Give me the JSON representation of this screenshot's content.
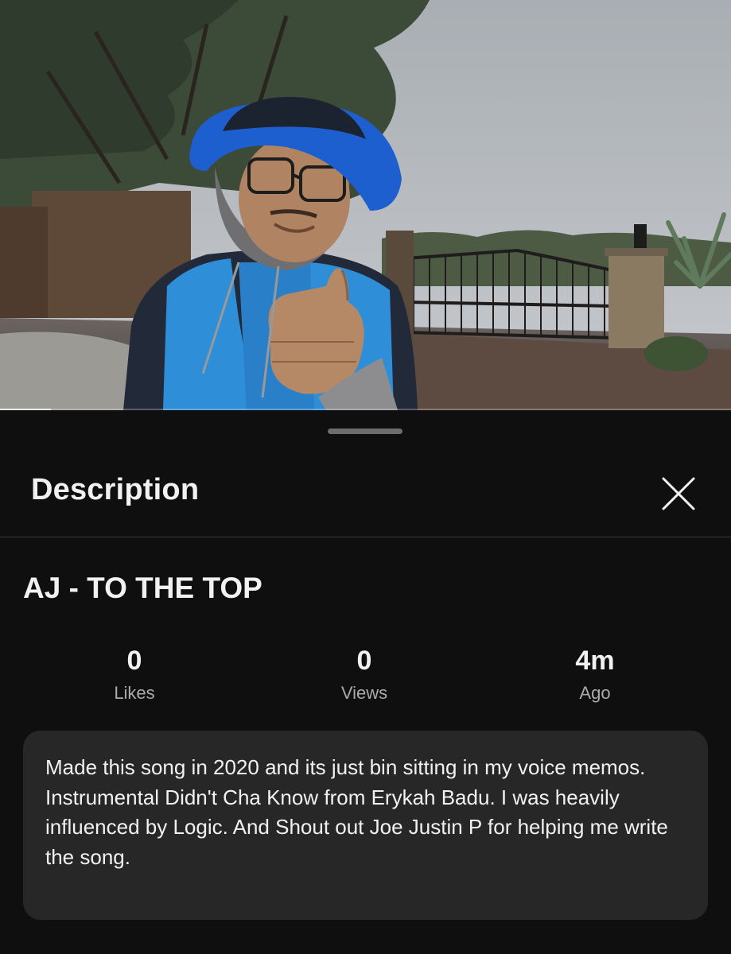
{
  "video": {
    "progress": 0.07
  },
  "sheet": {
    "title": "Description",
    "close_icon": "close-icon"
  },
  "video_title": "AJ - TO THE TOP",
  "stats": [
    {
      "value": "0",
      "label": "Likes"
    },
    {
      "value": "0",
      "label": "Views"
    },
    {
      "value": "4m",
      "label": "Ago"
    }
  ],
  "description": "Made this song in 2020 and its just bin sitting in my voice memos.\nInstrumental Didn't Cha Know from Erykah Badu. I was heavily influenced by Logic. And Shout out Joe Justin P for helping me write the song.",
  "colors": {
    "background": "#0f0f0f",
    "description_box": "#272727",
    "hat_blue": "#1e5fd0",
    "jacket_blue": "#2e8ed8"
  }
}
